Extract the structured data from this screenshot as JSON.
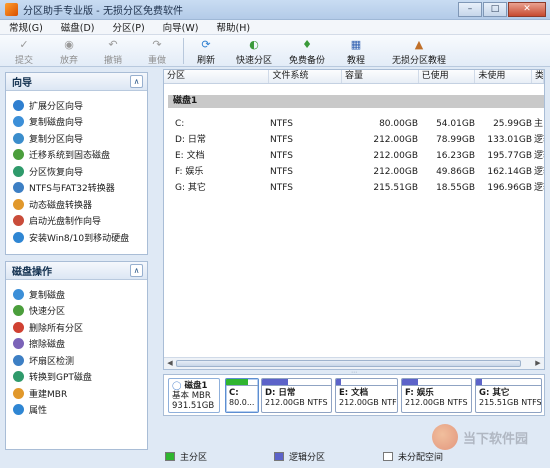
{
  "window": {
    "title": "分区助手专业版 - 无损分区免费软件",
    "buttons": [
      "0",
      "1",
      "r"
    ]
  },
  "menu": [
    "常规(G)",
    "磁盘(D)",
    "分区(P)",
    "向导(W)",
    "帮助(H)"
  ],
  "toolbar": {
    "items": [
      {
        "label": "提交",
        "icon": "commit-icon",
        "enabled": false
      },
      {
        "label": "放弃",
        "icon": "discard-icon",
        "enabled": false
      },
      {
        "label": "撤销",
        "icon": "undo-icon",
        "enabled": false
      },
      {
        "label": "重做",
        "icon": "redo-icon",
        "enabled": false
      },
      {
        "label": "刷新",
        "icon": "refresh-icon",
        "enabled": true
      },
      {
        "label": "快速分区",
        "icon": "quick-partition-icon",
        "enabled": true
      },
      {
        "label": "免费备份",
        "icon": "backup-icon",
        "enabled": true
      },
      {
        "label": "教程",
        "icon": "tutorial-icon",
        "enabled": true
      },
      {
        "label": "无损分区教程",
        "icon": "lossless-tutorial-icon",
        "enabled": true
      }
    ]
  },
  "wizard_panel": {
    "title": "向导",
    "items": [
      {
        "label": "扩展分区向导",
        "color": "#2f7fd0"
      },
      {
        "label": "复制磁盘向导",
        "color": "#3c8fd8"
      },
      {
        "label": "复制分区向导",
        "color": "#3b8dcc"
      },
      {
        "label": "迁移系统到固态磁盘",
        "color": "#4b9e3c"
      },
      {
        "label": "分区恢复向导",
        "color": "#2f9a6b"
      },
      {
        "label": "NTFS与FAT32转换器",
        "color": "#3d7fc4"
      },
      {
        "label": "动态磁盘转换器",
        "color": "#e1982b"
      },
      {
        "label": "启动光盘制作向导",
        "color": "#c94c3a"
      },
      {
        "label": "安装Win8/10到移动硬盘",
        "color": "#2f86d3"
      }
    ]
  },
  "disk_ops_panel": {
    "title": "磁盘操作",
    "items": [
      {
        "label": "复制磁盘",
        "color": "#3c8fd8"
      },
      {
        "label": "快速分区",
        "color": "#4b9e3c"
      },
      {
        "label": "删除所有分区",
        "color": "#d04132"
      },
      {
        "label": "擦除磁盘",
        "color": "#7b63b8"
      },
      {
        "label": "坏扇区检测",
        "color": "#3d7fc4"
      },
      {
        "label": "转换到GPT磁盘",
        "color": "#2f9a6b"
      },
      {
        "label": "重建MBR",
        "color": "#e1982b"
      },
      {
        "label": "属性",
        "color": "#2f86d3"
      }
    ]
  },
  "table": {
    "columns": [
      "分区",
      "文件系统",
      "容量",
      "已使用",
      "未使用",
      "类型"
    ],
    "disk_group": "磁盘1",
    "rows": [
      {
        "partition": "C:",
        "fs": "NTFS",
        "capacity": "80.00GB",
        "used": "54.01GB",
        "free": "25.99GB",
        "type": "主"
      },
      {
        "partition": "D: 日常",
        "fs": "NTFS",
        "capacity": "212.00GB",
        "used": "78.99GB",
        "free": "133.01GB",
        "type": "逻辑"
      },
      {
        "partition": "E: 文档",
        "fs": "NTFS",
        "capacity": "212.00GB",
        "used": "16.23GB",
        "free": "195.77GB",
        "type": "逻辑"
      },
      {
        "partition": "F: 娱乐",
        "fs": "NTFS",
        "capacity": "212.00GB",
        "used": "49.86GB",
        "free": "162.14GB",
        "type": "逻辑"
      },
      {
        "partition": "G: 其它",
        "fs": "NTFS",
        "capacity": "215.51GB",
        "used": "18.55GB",
        "free": "196.96GB",
        "type": "逻辑"
      }
    ]
  },
  "disk_map": {
    "disk_name": "磁盘1",
    "disk_type": "基本 MBR",
    "disk_size": "931.51GB",
    "partitions": [
      {
        "label": "C:",
        "size": "80.0...",
        "used_fraction": 0.675,
        "color": "#2fb52f",
        "selected": true
      },
      {
        "label": "D: 日常",
        "size": "212.00GB NTFS",
        "used_fraction": 0.373,
        "color": "#5c63c9",
        "selected": false
      },
      {
        "label": "E: 文档",
        "size": "212.00GB NTFS",
        "used_fraction": 0.077,
        "color": "#5c63c9",
        "selected": false
      },
      {
        "label": "F: 娱乐",
        "size": "212.00GB NTFS",
        "used_fraction": 0.235,
        "color": "#5c63c9",
        "selected": false
      },
      {
        "label": "G: 其它",
        "size": "215.51GB NTFS",
        "used_fraction": 0.086,
        "color": "#5c63c9",
        "selected": false
      }
    ]
  },
  "legend": [
    {
      "label": "主分区",
      "color": "#2fb52f"
    },
    {
      "label": "逻辑分区",
      "color": "#5c63c9"
    },
    {
      "label": "未分配空间",
      "color": "#ffffff"
    }
  ],
  "watermark": {
    "text": "当下软件园"
  }
}
